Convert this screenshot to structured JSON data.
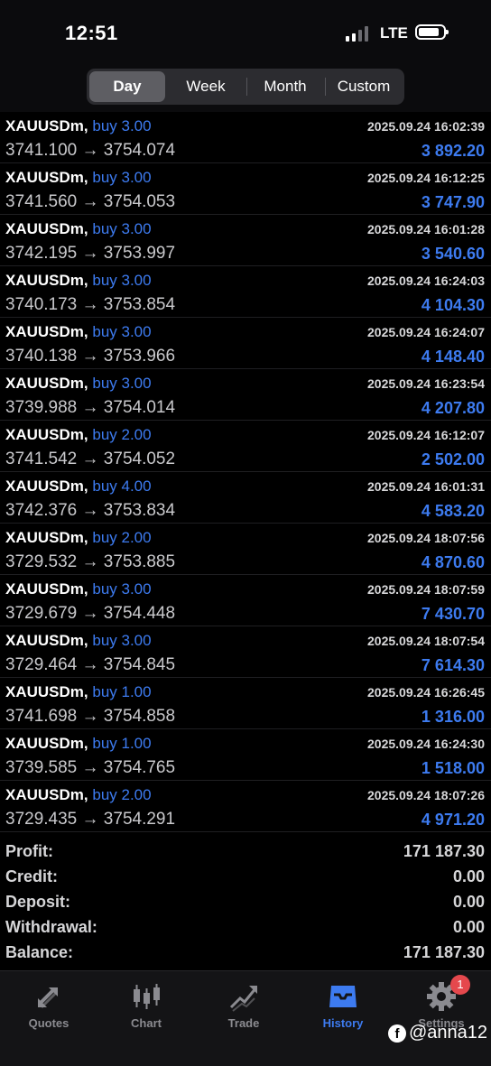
{
  "status_bar": {
    "time": "12:51",
    "network": "LTE"
  },
  "period_tabs": [
    {
      "label": "Day",
      "active": true
    },
    {
      "label": "Week",
      "active": false
    },
    {
      "label": "Month",
      "active": false
    },
    {
      "label": "Custom",
      "active": false
    }
  ],
  "trades": [
    {
      "symbol": "XAUUSDm,",
      "side": "buy 3.00",
      "prices": "3741.100 → 3754.074",
      "datetime": "2025.09.24 16:02:39",
      "profit": "3 892.20"
    },
    {
      "symbol": "XAUUSDm,",
      "side": "buy 3.00",
      "prices": "3741.560 → 3754.053",
      "datetime": "2025.09.24 16:12:25",
      "profit": "3 747.90"
    },
    {
      "symbol": "XAUUSDm,",
      "side": "buy 3.00",
      "prices": "3742.195 → 3753.997",
      "datetime": "2025.09.24 16:01:28",
      "profit": "3 540.60"
    },
    {
      "symbol": "XAUUSDm,",
      "side": "buy 3.00",
      "prices": "3740.173 → 3753.854",
      "datetime": "2025.09.24 16:24:03",
      "profit": "4 104.30"
    },
    {
      "symbol": "XAUUSDm,",
      "side": "buy 3.00",
      "prices": "3740.138 → 3753.966",
      "datetime": "2025.09.24 16:24:07",
      "profit": "4 148.40"
    },
    {
      "symbol": "XAUUSDm,",
      "side": "buy 3.00",
      "prices": "3739.988 → 3754.014",
      "datetime": "2025.09.24 16:23:54",
      "profit": "4 207.80"
    },
    {
      "symbol": "XAUUSDm,",
      "side": "buy 2.00",
      "prices": "3741.542 → 3754.052",
      "datetime": "2025.09.24 16:12:07",
      "profit": "2 502.00"
    },
    {
      "symbol": "XAUUSDm,",
      "side": "buy 4.00",
      "prices": "3742.376 → 3753.834",
      "datetime": "2025.09.24 16:01:31",
      "profit": "4 583.20"
    },
    {
      "symbol": "XAUUSDm,",
      "side": "buy 2.00",
      "prices": "3729.532 → 3753.885",
      "datetime": "2025.09.24 18:07:56",
      "profit": "4 870.60"
    },
    {
      "symbol": "XAUUSDm,",
      "side": "buy 3.00",
      "prices": "3729.679 → 3754.448",
      "datetime": "2025.09.24 18:07:59",
      "profit": "7 430.70"
    },
    {
      "symbol": "XAUUSDm,",
      "side": "buy 3.00",
      "prices": "3729.464 → 3754.845",
      "datetime": "2025.09.24 18:07:54",
      "profit": "7 614.30"
    },
    {
      "symbol": "XAUUSDm,",
      "side": "buy 1.00",
      "prices": "3741.698 → 3754.858",
      "datetime": "2025.09.24 16:26:45",
      "profit": "1 316.00"
    },
    {
      "symbol": "XAUUSDm,",
      "side": "buy 1.00",
      "prices": "3739.585 → 3754.765",
      "datetime": "2025.09.24 16:24:30",
      "profit": "1 518.00"
    },
    {
      "symbol": "XAUUSDm,",
      "side": "buy 2.00",
      "prices": "3729.435 → 3754.291",
      "datetime": "2025.09.24 18:07:26",
      "profit": "4 971.20"
    }
  ],
  "summary": [
    {
      "label": "Profit:",
      "value": "171 187.30"
    },
    {
      "label": "Credit:",
      "value": "0.00"
    },
    {
      "label": "Deposit:",
      "value": "0.00"
    },
    {
      "label": "Withdrawal:",
      "value": "0.00"
    },
    {
      "label": "Balance:",
      "value": "171 187.30"
    }
  ],
  "bottom_nav": [
    {
      "label": "Quotes",
      "icon": "quotes-arrows-icon",
      "active": false
    },
    {
      "label": "Chart",
      "icon": "candlestick-chart-icon",
      "active": false
    },
    {
      "label": "Trade",
      "icon": "trend-line-icon",
      "active": false
    },
    {
      "label": "History",
      "icon": "inbox-tray-icon",
      "active": true
    },
    {
      "label": "Settings",
      "icon": "gear-icon",
      "active": false,
      "badge": "1"
    }
  ],
  "watermark": "@anna12",
  "colors": {
    "accent_blue": "#3d7bf0",
    "background": "#000000",
    "badge_red": "#e5484d"
  }
}
